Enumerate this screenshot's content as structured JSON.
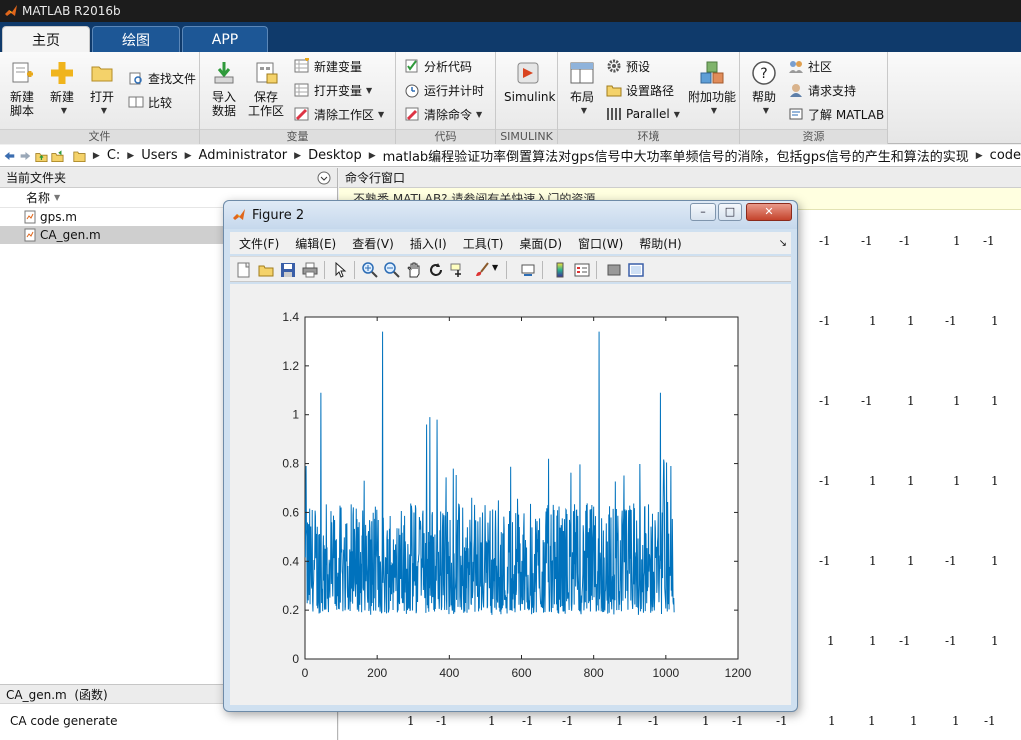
{
  "window": {
    "title": "MATLAB R2016b"
  },
  "tabs": [
    {
      "label": "主页",
      "active": true
    },
    {
      "label": "绘图",
      "active": false
    },
    {
      "label": "APP",
      "active": false
    }
  ],
  "ribbon": {
    "file_group": {
      "label": "文件",
      "new_script": "新建\n脚本",
      "new": "新建",
      "open": "打开",
      "find_files": "查找文件",
      "compare": "比较"
    },
    "variable_group": {
      "label": "变量",
      "import_data": "导入\n数据",
      "save_workspace": "保存\n工作区",
      "new_variable": "新建变量",
      "open_variable": "打开变量",
      "clear_workspace": "清除工作区"
    },
    "code_group": {
      "label": "代码",
      "analyze_code": "分析代码",
      "run_and_time": "运行并计时",
      "clear_commands": "清除命令"
    },
    "simulink_group": {
      "label": "SIMULINK",
      "simulink": "Simulink"
    },
    "env_group": {
      "label": "环境",
      "layout": "布局",
      "preferences": "预设",
      "set_path": "设置路径",
      "parallel": "Parallel",
      "addons": "附加功能"
    },
    "resources_group": {
      "label": "资源",
      "help": "帮助",
      "community": "社区",
      "request_support": "请求支持",
      "learn_matlab": "了解 MATLAB"
    }
  },
  "address": {
    "crumbs": [
      "C:",
      "Users",
      "Administrator",
      "Desktop",
      "matlab编程验证功率倒置算法对gps信号中大功率单频信号的消除，包括gps信号的产生和算法的实现",
      "code"
    ]
  },
  "current_folder": {
    "title": "当前文件夹",
    "column_name": "名称",
    "files": [
      {
        "name": "gps.m",
        "selected": false
      },
      {
        "name": "CA_gen.m",
        "selected": true
      }
    ],
    "detail_title": "CA_gen.m  (函数)",
    "detail_text": "CA code generate"
  },
  "command_window": {
    "title": "命令行窗口",
    "banner": "不熟悉 MATLAB? 请参阅有关快速入门的资源。",
    "rows_partial": [
      [
        "-1",
        "-1",
        "-1",
        "1",
        "-1"
      ],
      [
        "-1",
        "1",
        "1",
        "-1",
        "1"
      ],
      [
        "-1",
        "-1",
        "1",
        "1",
        "1"
      ],
      [
        "-1",
        "1",
        "1",
        "1",
        "1"
      ],
      [
        "-1",
        "1",
        "1",
        "-1",
        "1"
      ],
      [
        "1",
        "1",
        "-1",
        "-1",
        "1"
      ]
    ],
    "row_full": [
      "1",
      "-1",
      "1",
      "-1",
      "-1",
      "1",
      "-1",
      "1",
      "-1",
      "-1",
      "1",
      "1",
      "1",
      "1",
      "-1"
    ]
  },
  "figure": {
    "title": "Figure 2",
    "menu": [
      "文件(F)",
      "编辑(E)",
      "查看(V)",
      "插入(I)",
      "工具(T)",
      "桌面(D)",
      "窗口(W)",
      "帮助(H)"
    ],
    "toolbar_icons": [
      "new-figure-icon",
      "open-file-icon",
      "save-icon",
      "print-icon",
      "pointer-icon",
      "zoom-in-icon",
      "zoom-out-icon",
      "pan-icon",
      "rotate-icon",
      "data-cursor-icon",
      "brush-icon",
      "link-plot-icon",
      "colorbar-icon",
      "legend-icon",
      "hide-plot-tools-icon",
      "show-plot-tools-icon"
    ]
  },
  "chart_data": {
    "type": "line",
    "title": "",
    "xlabel": "",
    "ylabel": "",
    "xlim": [
      0,
      1200
    ],
    "ylim": [
      0,
      1.4
    ],
    "xticks": [
      "0",
      "200",
      "400",
      "600",
      "800",
      "1000",
      "1200"
    ],
    "yticks": [
      "0",
      "0.2",
      "0.4",
      "0.6",
      "0.8",
      "1",
      "1.2",
      "1.4"
    ],
    "grid": false,
    "series": [
      {
        "color": "#0072bd",
        "n_points": 1023,
        "baseline": 0.2,
        "typical_range": [
          0.2,
          0.65
        ],
        "peaks": [
          [
            2,
            0.79
          ],
          [
            43,
            1.09
          ],
          [
            214,
            1.34
          ],
          [
            336,
            0.96
          ],
          [
            345,
            0.99
          ],
          [
            365,
            0.98
          ],
          [
            674,
            0.82
          ],
          [
            814,
            1.34
          ],
          [
            984,
            1.09
          ],
          [
            1013,
            0.79
          ]
        ]
      }
    ]
  }
}
